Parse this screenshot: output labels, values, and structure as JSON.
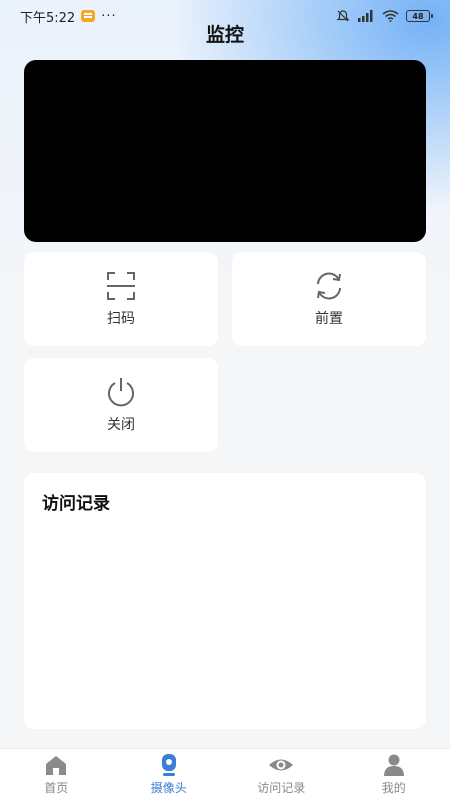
{
  "status_bar": {
    "time": "下午5:22",
    "more": "···",
    "battery": "48"
  },
  "page": {
    "title": "监控"
  },
  "actions": {
    "scan_label": "扫码",
    "front_label": "前置",
    "close_label": "关闭"
  },
  "records": {
    "title": "访问记录"
  },
  "tabbar": {
    "items": [
      {
        "label": "首页"
      },
      {
        "label": "摄像头"
      },
      {
        "label": "访问记录"
      },
      {
        "label": "我的"
      }
    ],
    "active_color": "#3a7fd5",
    "inactive_color": "#888888"
  },
  "colors": {
    "video_bg": "#000000",
    "accent_blue": "#74b2f6"
  }
}
